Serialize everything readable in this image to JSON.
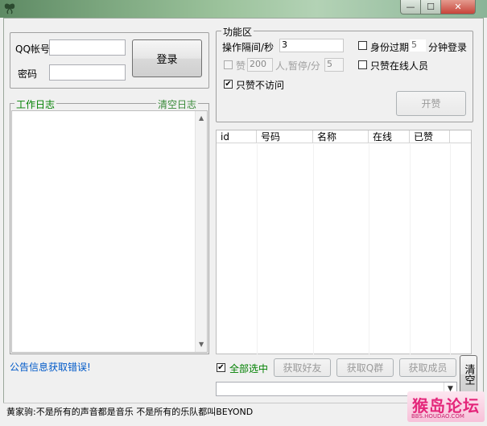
{
  "login": {
    "qq_label": "QQ帐号",
    "qq_value": "",
    "pwd_label": "密码",
    "pwd_value": "",
    "login_button": "登录"
  },
  "log": {
    "title": "工作日志",
    "clear_link": "清空日志"
  },
  "func": {
    "title": "功能区",
    "interval_label": "操作隔间/秒",
    "interval_value": "3",
    "expire_label_pre": "身份过期",
    "expire_value": "5",
    "expire_label_post": "分钟登录",
    "like_label": "赞",
    "like_value": "200",
    "pause_label": "人,暂停/分",
    "pause_value": "5",
    "online_only_label": "只赞在线人员",
    "no_visit_label": "只赞不访问",
    "start_button": "开赞"
  },
  "table": {
    "columns": [
      "id",
      "号码",
      "名称",
      "在线",
      "已赞"
    ],
    "rows": []
  },
  "bottom": {
    "notice": "公告信息获取错误!",
    "select_all_label": "全部选中",
    "get_friends": "获取好友",
    "get_groups": "获取Q群",
    "get_members": "获取成员",
    "clear_label": "清空",
    "combo_value": ""
  },
  "status": {
    "text": "黄家驹:不是所有的声音都是音乐 不是所有的乐队都叫BEYOND"
  },
  "watermark": {
    "title": "猴岛论坛",
    "url": "BBS.HOUDAO.COM"
  },
  "colors": {
    "accent_green": "#008000",
    "notice_blue": "#0059c8"
  }
}
